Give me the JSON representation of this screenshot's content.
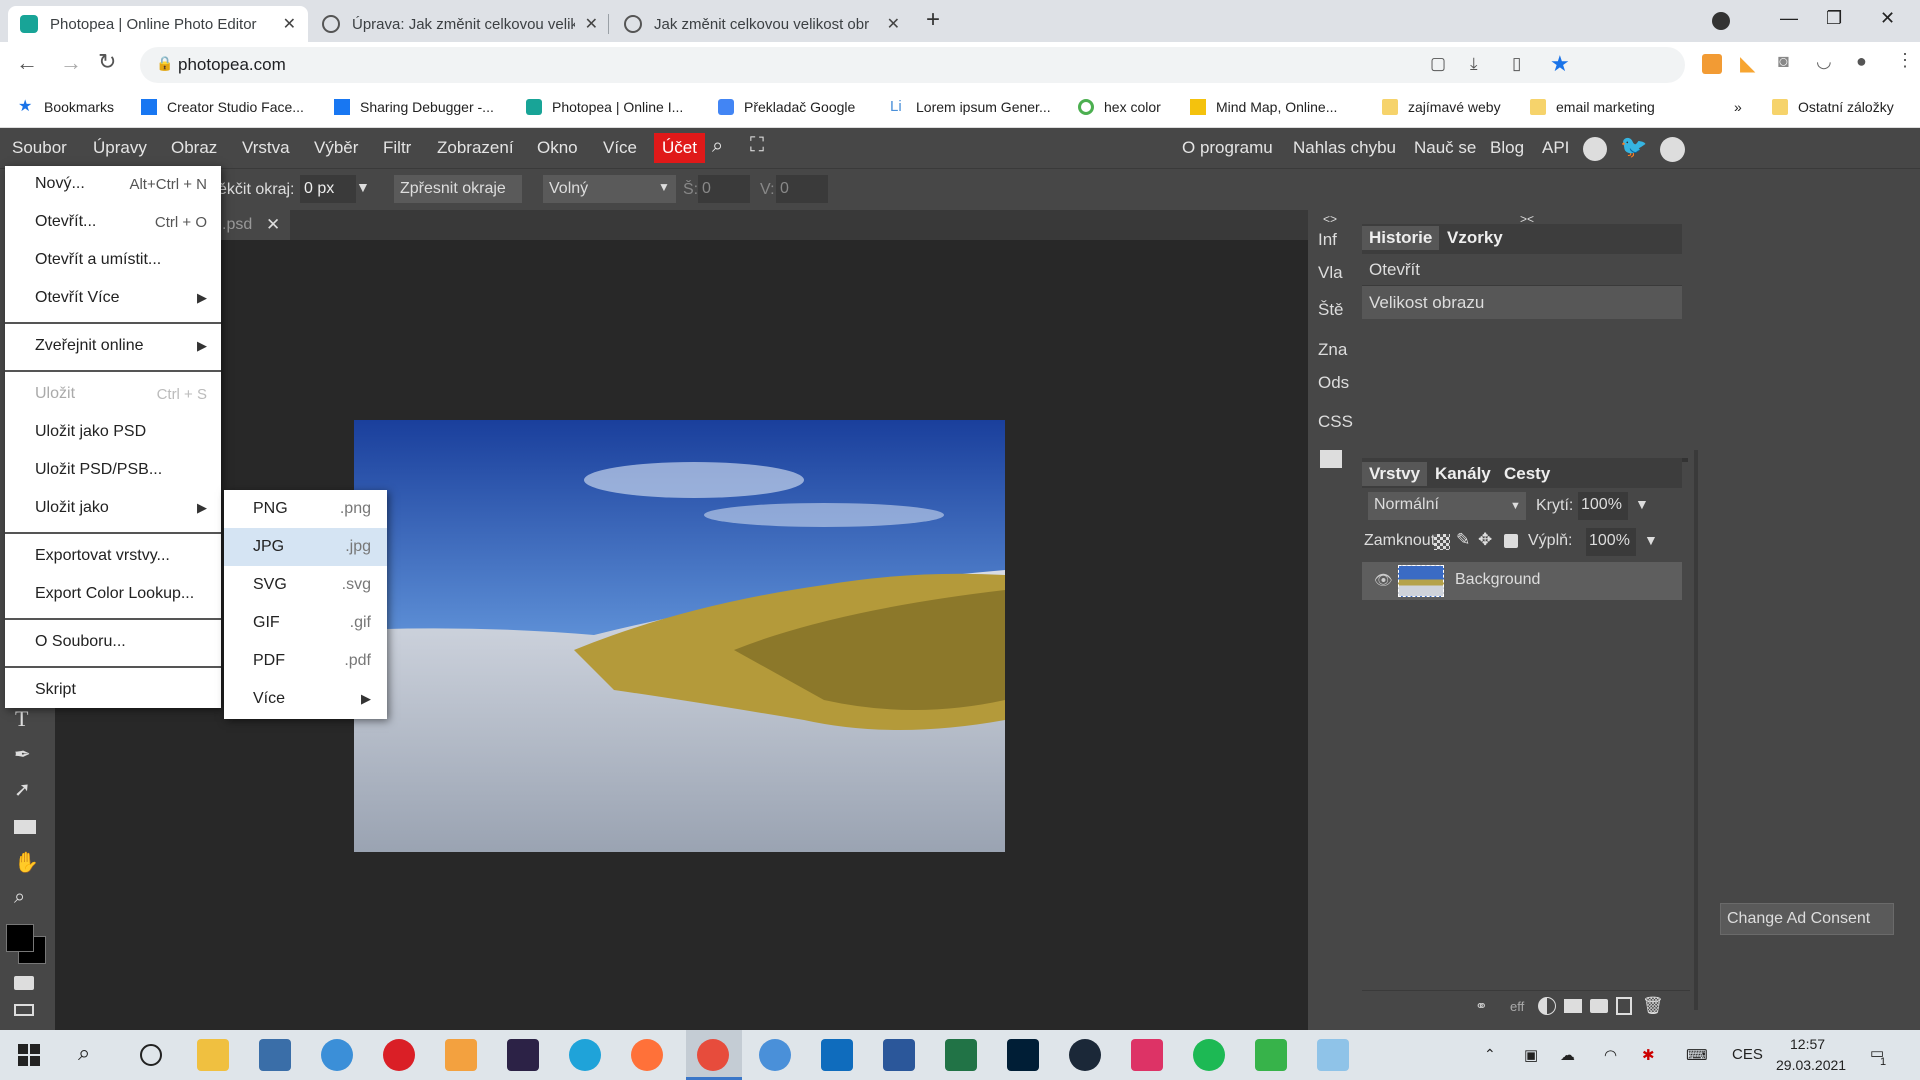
{
  "browser": {
    "tabs": [
      {
        "title": "Photopea | Online Photo Editor",
        "active": true
      },
      {
        "title": "Úprava: Jak změnit celkovou velik"
      },
      {
        "title": "Jak změnit celkovou velikost obr"
      }
    ],
    "new_tab": "+",
    "url": "photopea.com",
    "bookmarks": [
      "Bookmarks",
      "Creator Studio Face...",
      "Sharing Debugger -...",
      "Photopea | Online I...",
      "Překladač Google",
      "Lorem ipsum Gener...",
      "hex color",
      "Mind Map, Online...",
      "zajímavé weby",
      "email marketing"
    ],
    "bookmarks_overflow": "»",
    "other_bookmarks": "Ostatní záložky"
  },
  "menubar": {
    "items": [
      "Soubor",
      "Úpravy",
      "Obraz",
      "Vrstva",
      "Výběr",
      "Filtr",
      "Zobrazení",
      "Okno",
      "Více",
      "Účet"
    ],
    "right": [
      "O programu",
      "Nahlas chybu",
      "Nauč se",
      "Blog",
      "API"
    ]
  },
  "options": {
    "feather_label": "ěkčit okraj:",
    "feather_value": "0 px",
    "refine_button": "Zpřesnit okraje",
    "style_select": "Volný",
    "w_label": "Š:",
    "w_value": "0",
    "h_label": "V:",
    "h_value": "0"
  },
  "document_tab": {
    "name_fragment": ".psd",
    "close": "✕"
  },
  "file_menu": {
    "items": [
      {
        "label": "Nový...",
        "shortcut": "Alt+Ctrl + N"
      },
      {
        "label": "Otevřít...",
        "shortcut": "Ctrl + O"
      },
      {
        "label": "Otevřít a umístit..."
      },
      {
        "label": "Otevřít Více",
        "submenu": true
      },
      {
        "label": "Zveřejnit online",
        "submenu": true
      },
      {
        "label": "Uložit",
        "shortcut": "Ctrl + S",
        "disabled": true
      },
      {
        "label": "Uložit jako PSD"
      },
      {
        "label": "Uložit PSD/PSB..."
      },
      {
        "label": "Uložit jako",
        "submenu": true
      },
      {
        "label": "Exportovat vrstvy..."
      },
      {
        "label": "Export Color Lookup..."
      },
      {
        "label": "O Souboru..."
      },
      {
        "label": "Skript"
      }
    ]
  },
  "save_as_submenu": {
    "items": [
      {
        "label": "PNG",
        "ext": ".png"
      },
      {
        "label": "JPG",
        "ext": ".jpg",
        "highlighted": true
      },
      {
        "label": "SVG",
        "ext": ".svg"
      },
      {
        "label": "GIF",
        "ext": ".gif"
      },
      {
        "label": "PDF",
        "ext": ".pdf"
      },
      {
        "label": "Více",
        "ext": "▶"
      }
    ]
  },
  "side_tabs": [
    "Inf",
    "Vla",
    "Ště",
    "Zna",
    "Ods",
    "CSS"
  ],
  "collapse_left": "<>",
  "collapse_right": "><",
  "history_panel": {
    "tabs": [
      "Historie",
      "Vzorky"
    ],
    "entries": [
      "Otevřít",
      "Velikost obrazu"
    ]
  },
  "layers_panel": {
    "tabs": [
      "Vrstvy",
      "Kanály",
      "Cesty"
    ],
    "blend_mode": "Normální",
    "opacity_label": "Krytí:",
    "opacity_value": "100%",
    "lock_label": "Zamknout:",
    "fill_label": "Výplň:",
    "fill_value": "100%",
    "layers": [
      {
        "name": "Background"
      }
    ],
    "bottom_eff": "eff"
  },
  "ad_consent_button": "Change Ad Consent",
  "taskbar": {
    "language": "CES",
    "time": "12:57",
    "date": "29.03.2021",
    "notification_count": "1"
  }
}
